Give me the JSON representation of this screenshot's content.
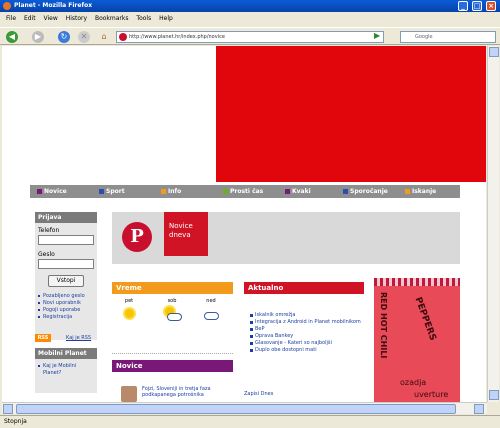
{
  "window": {
    "title": "Planet - Mozilla Firefox"
  },
  "menu": [
    "File",
    "Edit",
    "View",
    "History",
    "Bookmarks",
    "Tools",
    "Help"
  ],
  "toolbar": {
    "url": "http://www.planet.hr/index.php/novice",
    "search_placeholder": "Google"
  },
  "nav": [
    {
      "label": "Novice",
      "color": "#7a1877"
    },
    {
      "label": "Sport",
      "color": "#2a4fb2"
    },
    {
      "label": "Info",
      "color": "#f19a1c"
    },
    {
      "label": "Prosti čas",
      "color": "#6ab023"
    },
    {
      "label": "Kvaki",
      "color": "#7a1877"
    },
    {
      "label": "Sporočanje",
      "color": "#2a4fb2"
    },
    {
      "label": "Iskanje",
      "color": "#f19a1c"
    }
  ],
  "login": {
    "title": "Prijava",
    "user_label": "Telefon",
    "pass_label": "Geslo",
    "button": "Vstopi",
    "links": [
      "Pozabljeno geslo",
      "Novi uporabnik",
      "Pogoji uporabe",
      "Registracija"
    ]
  },
  "rss": {
    "badge": "RSS",
    "link": "Kaj je RSS"
  },
  "mobile": {
    "title": "Mobilni Planet",
    "link": "Kaj je Mobilni Planet?"
  },
  "header": {
    "logo": "P",
    "title_line1": "Novice",
    "title_line2": "dneva"
  },
  "weather": {
    "title": "Vreme",
    "days": [
      {
        "label": "pet",
        "icon": "sun-icon"
      },
      {
        "label": "sob",
        "icon": "sun-cloud-icon"
      },
      {
        "label": "ned",
        "icon": "cloud-icon"
      }
    ]
  },
  "novice_box": {
    "title": "Novice",
    "text": "Fojzi, Sloveniji in tretja faza podkapanega potrošnika"
  },
  "aktualno": {
    "title": "Aktualno",
    "items": [
      "Iskalnik omrežja",
      "Integracija z Android in Planet mobilnikom",
      "BeP",
      "Oprava Bankey",
      "Glasovanje - Kateri so najboljši",
      "Duplo obe dostopni mati"
    ],
    "more": "Zapisi Dnes"
  },
  "ad": {
    "line1": "RED HOT CHILI",
    "line2": "PEPPERS",
    "word1": "ozadja",
    "word2": "uverture"
  },
  "status": {
    "text": "Stopnja"
  }
}
